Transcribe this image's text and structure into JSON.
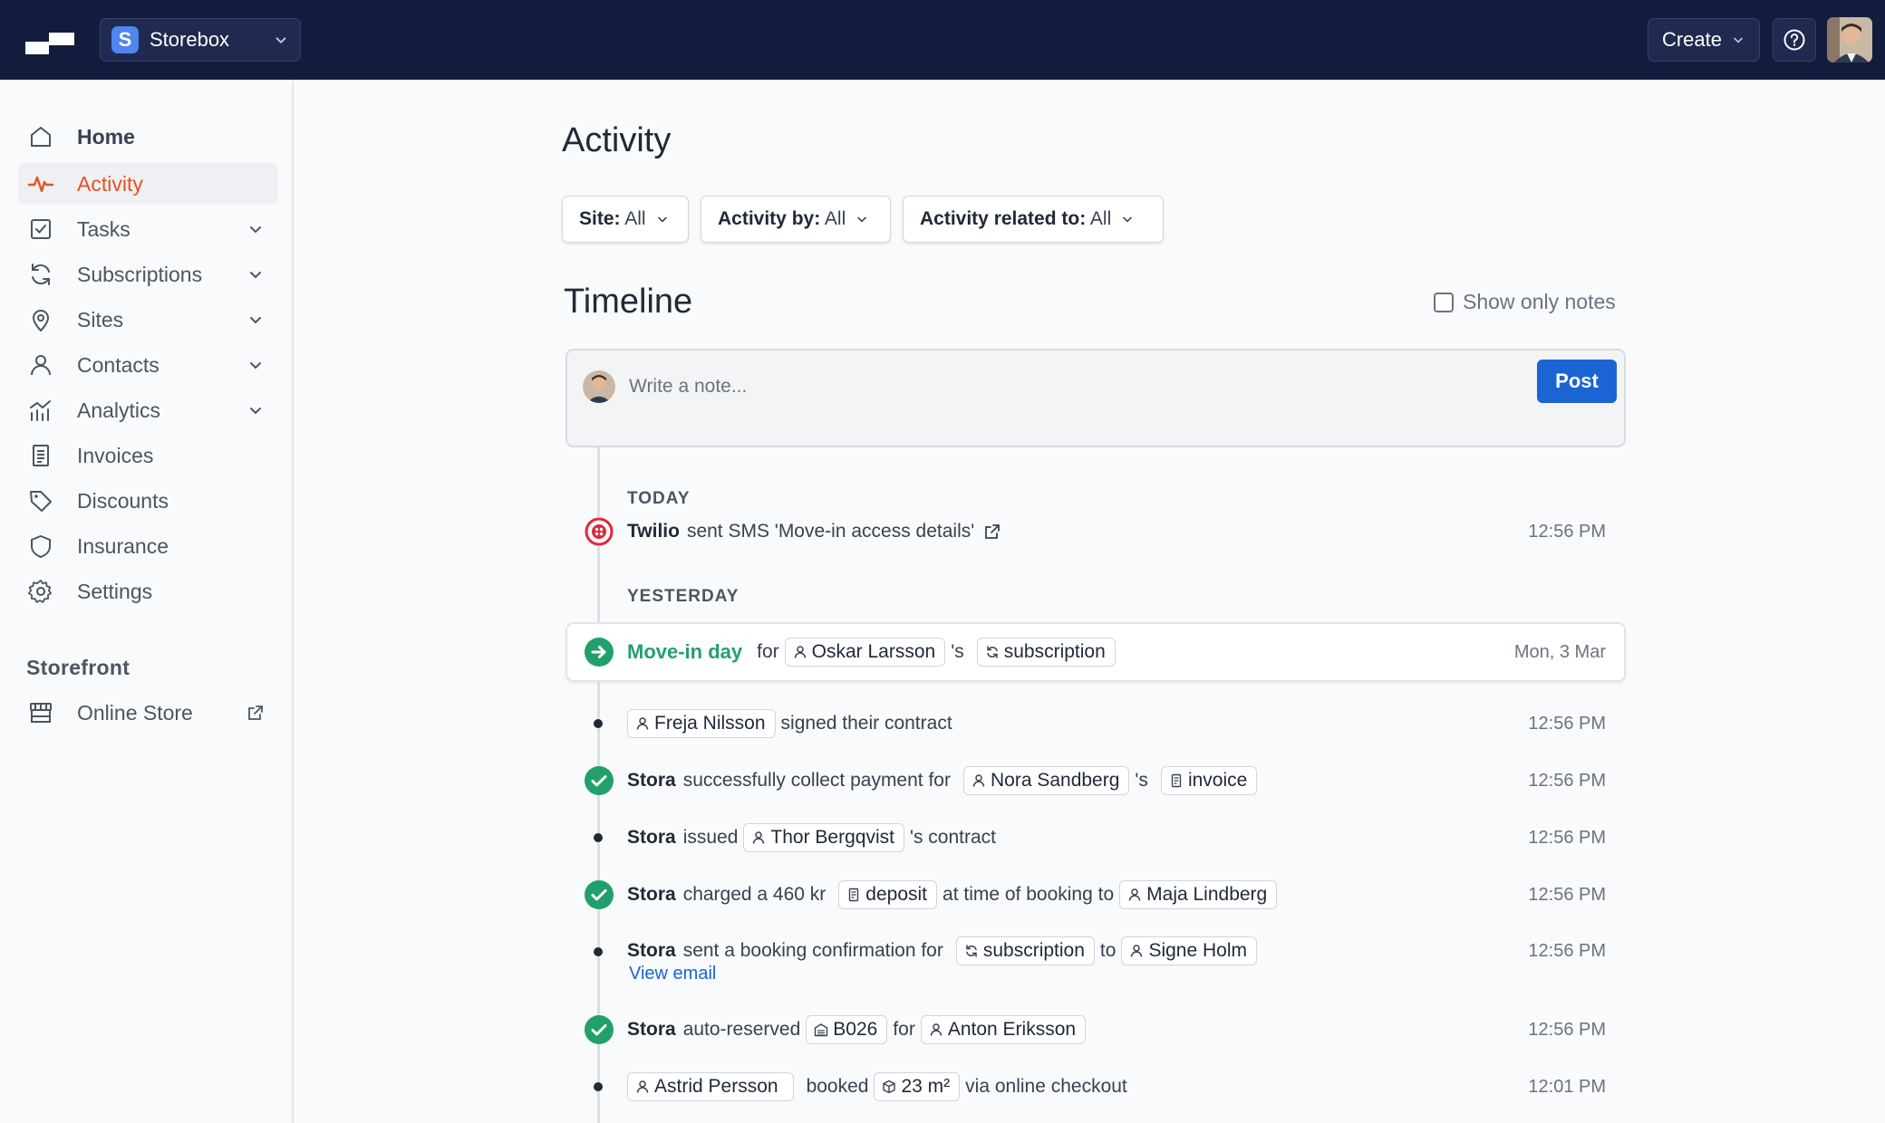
{
  "topbar": {
    "org_initial": "S",
    "org_name": "Storebox",
    "create_label": "Create"
  },
  "sidebar": {
    "items": [
      {
        "label": "Home"
      },
      {
        "label": "Activity"
      },
      {
        "label": "Tasks"
      },
      {
        "label": "Subscriptions"
      },
      {
        "label": "Sites"
      },
      {
        "label": "Contacts"
      },
      {
        "label": "Analytics"
      },
      {
        "label": "Invoices"
      },
      {
        "label": "Discounts"
      },
      {
        "label": "Insurance"
      },
      {
        "label": "Settings"
      }
    ],
    "storefront_title": "Storefront",
    "online_store_label": "Online Store"
  },
  "main": {
    "title": "Activity",
    "filters": [
      {
        "key": "Site:",
        "value": "All"
      },
      {
        "key": "Activity by:",
        "value": "All"
      },
      {
        "key": "Activity related to:",
        "value": "All"
      }
    ],
    "timeline_title": "Timeline",
    "show_only_notes": "Show only notes",
    "note_placeholder": "Write a note...",
    "post_label": "Post"
  },
  "timeline": {
    "today_label": "TODAY",
    "yesterday_label": "YESTERDAY",
    "twilio": {
      "actor": "Twilio",
      "text": "sent SMS 'Move-in access details'",
      "time": "12:56 PM"
    },
    "movein": {
      "title": "Move-in day",
      "for": "for",
      "person": "Oskar Larsson",
      "possessive": "'s",
      "tag": "subscription",
      "time": "Mon, 3 Mar"
    },
    "e1": {
      "person": "Freja Nilsson",
      "text": "signed their contract",
      "time": "12:56 PM"
    },
    "e2": {
      "actor": "Stora",
      "text": "successfully collect payment for",
      "person": "Nora Sandberg",
      "possessive": "'s",
      "tag": "invoice",
      "time": "12:56 PM"
    },
    "e3": {
      "actor": "Stora",
      "text": "issued",
      "person": "Thor Bergqvist",
      "after": "'s contract",
      "time": "12:56 PM"
    },
    "e4": {
      "actor": "Stora",
      "text": "charged a 460 kr",
      "tag": "deposit",
      "middle": "at time of booking to",
      "person": "Maja Lindberg",
      "time": "12:56 PM"
    },
    "e5": {
      "actor": "Stora",
      "text": "sent a booking confirmation for",
      "tag": "subscription",
      "middle": "to",
      "person": "Signe Holm",
      "link": "View email",
      "time": "12:56 PM"
    },
    "e6": {
      "actor": "Stora",
      "text": "auto-reserved",
      "tag": "B026",
      "middle": "for",
      "person": "Anton Eriksson",
      "time": "12:56 PM"
    },
    "e7": {
      "person": "Astrid Persson",
      "text": "booked",
      "tag": "23 m²",
      "after": "via online checkout",
      "time": "12:01 PM"
    }
  },
  "colors": {
    "topbar": "#141c3d",
    "accent_active": "#e8531f",
    "primary": "#1b64d4",
    "success": "#22a06b",
    "twilio": "#e3263a"
  }
}
